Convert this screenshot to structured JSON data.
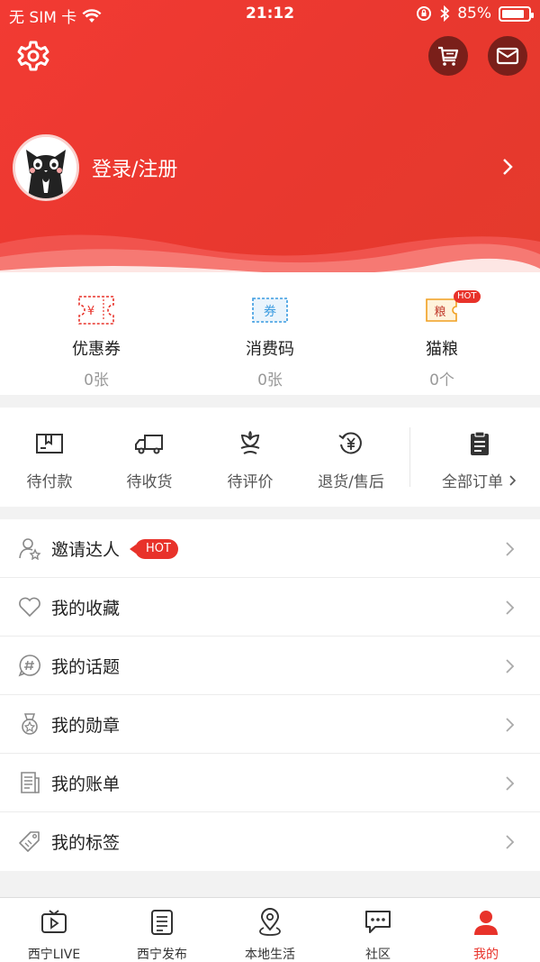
{
  "status_bar": {
    "carrier": "无 SIM 卡",
    "time": "21:12",
    "battery": "85%"
  },
  "header": {
    "login_text": "登录/注册"
  },
  "stats": [
    {
      "label": "优惠券",
      "value": "0张",
      "icon": "coupon-icon",
      "color": "#e8322a"
    },
    {
      "label": "消费码",
      "value": "0张",
      "icon": "voucher-code-icon",
      "color": "#3a9be0",
      "icon_text": "券"
    },
    {
      "label": "猫粮",
      "value": "0个",
      "icon": "cat-food-icon",
      "color": "#f0a020",
      "icon_text": "粮",
      "badge": "HOT"
    }
  ],
  "coupon_icon_text": "¥",
  "orders": [
    {
      "label": "待付款",
      "icon": "wallet-icon"
    },
    {
      "label": "待收货",
      "icon": "truck-icon"
    },
    {
      "label": "待评价",
      "icon": "flower-icon"
    },
    {
      "label": "退货/售后",
      "icon": "refund-icon"
    },
    {
      "label": "全部订单",
      "icon": "clipboard-icon"
    }
  ],
  "menu": [
    {
      "label": "邀请达人",
      "icon": "invite-user-icon",
      "badge": "HOT"
    },
    {
      "label": "我的收藏",
      "icon": "heart-icon"
    },
    {
      "label": "我的话题",
      "icon": "hashtag-icon"
    },
    {
      "label": "我的勋章",
      "icon": "medal-icon"
    },
    {
      "label": "我的账单",
      "icon": "bill-icon"
    },
    {
      "label": "我的标签",
      "icon": "tag-icon"
    }
  ],
  "tabs": [
    {
      "label": "西宁LIVE",
      "icon": "tv-icon",
      "active": false
    },
    {
      "label": "西宁发布",
      "icon": "news-icon",
      "active": false
    },
    {
      "label": "本地生活",
      "icon": "location-icon",
      "active": false
    },
    {
      "label": "社区",
      "icon": "chat-icon",
      "active": false
    },
    {
      "label": "我的",
      "icon": "person-icon",
      "active": true
    }
  ],
  "colors": {
    "primary": "#e8322a",
    "header_dark": "#7a1f1a",
    "muted": "#999999"
  }
}
